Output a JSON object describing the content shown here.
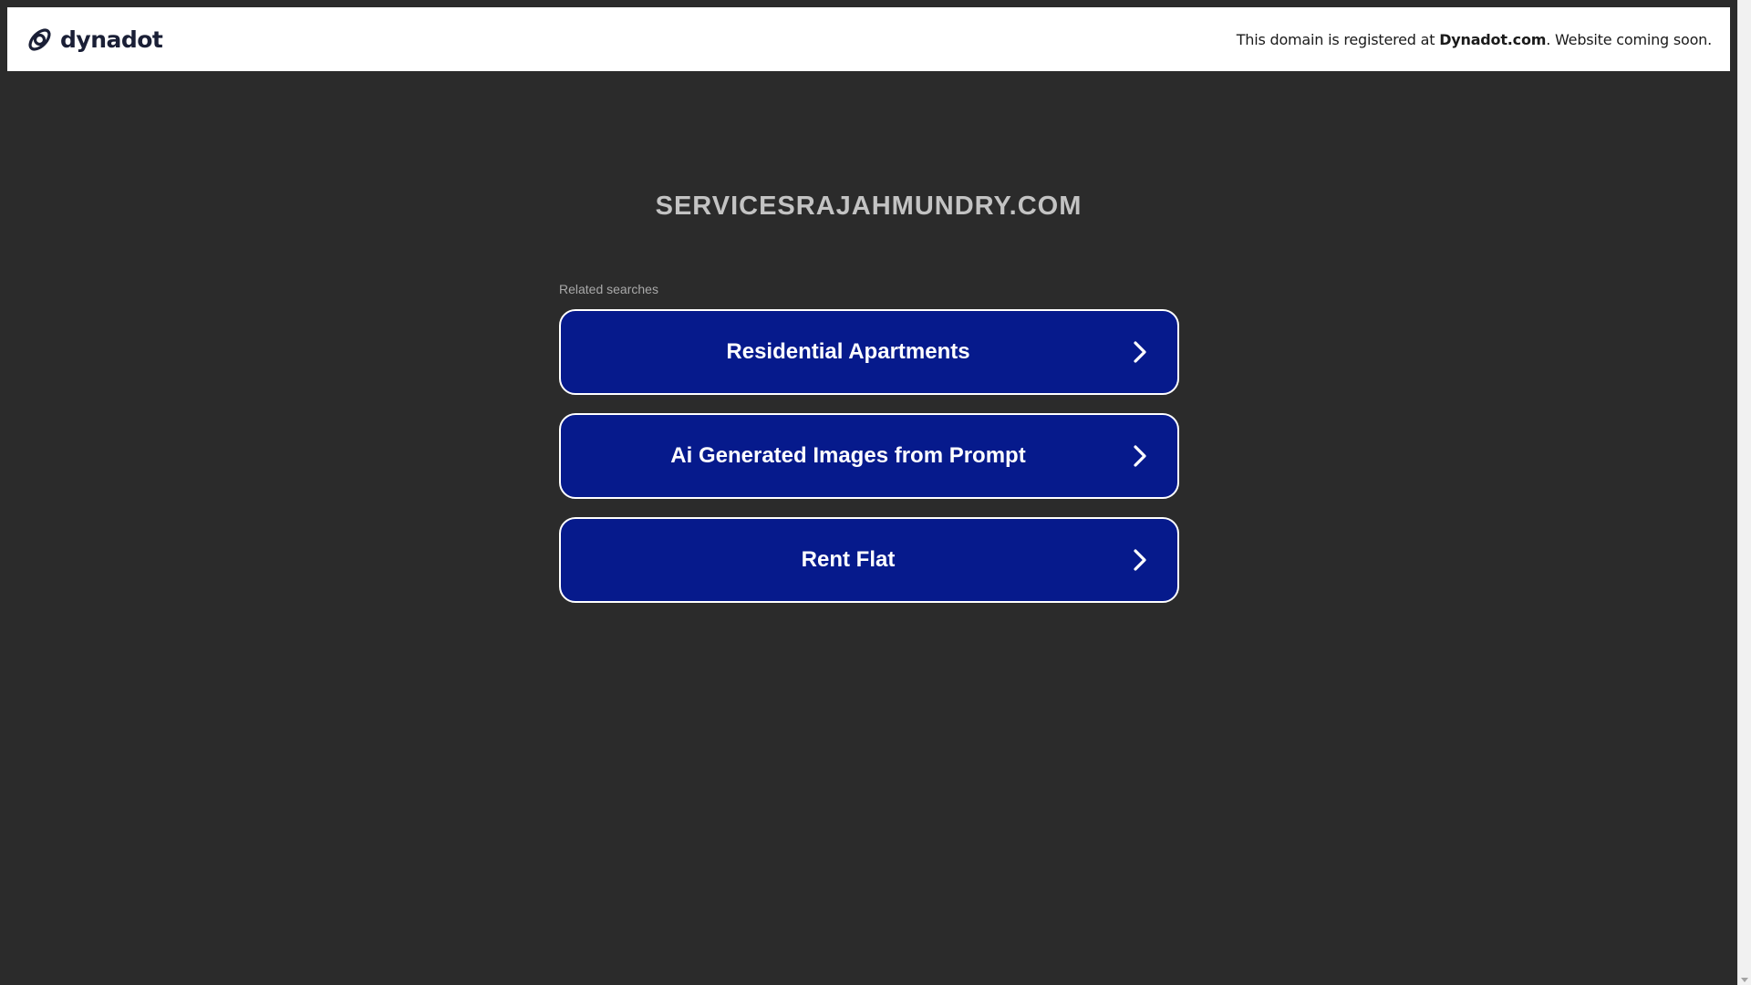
{
  "banner": {
    "brand_name": "dynadot",
    "brand_icon": "dynadot-logo-icon",
    "notice_prefix": "This domain is registered at ",
    "notice_registrar": "Dynadot.com",
    "notice_suffix": ". Website coming soon."
  },
  "main": {
    "domain": "SERVICESRAJAHMUNDRY.COM",
    "related_label": "Related searches",
    "links": [
      {
        "label": "Residential Apartments",
        "icon": "chevron-right-icon"
      },
      {
        "label": "Ai Generated Images from Prompt",
        "icon": "chevron-right-icon"
      },
      {
        "label": "Rent Flat",
        "icon": "chevron-right-icon"
      }
    ]
  },
  "colors": {
    "background": "#2b2b2b",
    "button": "#061a8c",
    "button_border": "#ffffff",
    "title": "#c3c3c3",
    "banner": "#ffffff"
  }
}
